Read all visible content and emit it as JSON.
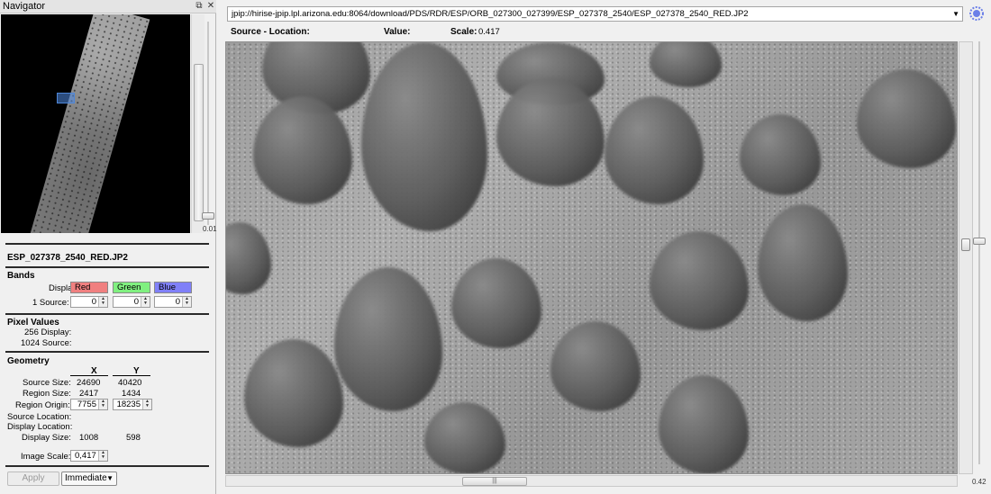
{
  "navigator": {
    "title": "Navigator",
    "zoom_value": "0.01"
  },
  "info": {
    "filename": "ESP_027378_2540_RED.JP2",
    "bands": {
      "heading": "Bands",
      "display_label": "Display:",
      "source_label": "1 Source:",
      "red_label": "Red",
      "green_label": "Green",
      "blue_label": "Blue",
      "red_value": "0",
      "green_value": "0",
      "blue_value": "0"
    },
    "pixel_values": {
      "heading": "Pixel Values",
      "display_label": "256 Display:",
      "source_label": "1024 Source:"
    },
    "geometry": {
      "heading": "Geometry",
      "col_x": "X",
      "col_y": "Y",
      "source_size_label": "Source Size:",
      "source_size_x": "24690",
      "source_size_y": "40420",
      "region_size_label": "Region Size:",
      "region_size_x": "2417",
      "region_size_y": "1434",
      "region_origin_label": "Region Origin:",
      "region_origin_x": "7755",
      "region_origin_y": "18235",
      "source_location_label": "Source Location:",
      "display_location_label": "Display Location:",
      "display_size_label": "Display Size:",
      "display_size_x": "1008",
      "display_size_y": "598"
    },
    "image_scale_label": "Image Scale:",
    "image_scale_value": "0,417",
    "apply_label": "Apply",
    "mode_value": "Immediate"
  },
  "viewer": {
    "url": "jpip://hirise-jpip.lpl.arizona.edu:8064/download/PDS/RDR/ESP/ORB_027300_027399/ESP_027378_2540/ESP_027378_2540_RED.JP2",
    "source_location_label": "Source - Location:",
    "value_label": "Value:",
    "scale_label": "Scale:",
    "scale_value": "0.417",
    "zoom_value": "0.42"
  },
  "colors": {
    "red_band": "#f08080",
    "green_band": "#80f080",
    "blue_band": "#8080f8"
  }
}
